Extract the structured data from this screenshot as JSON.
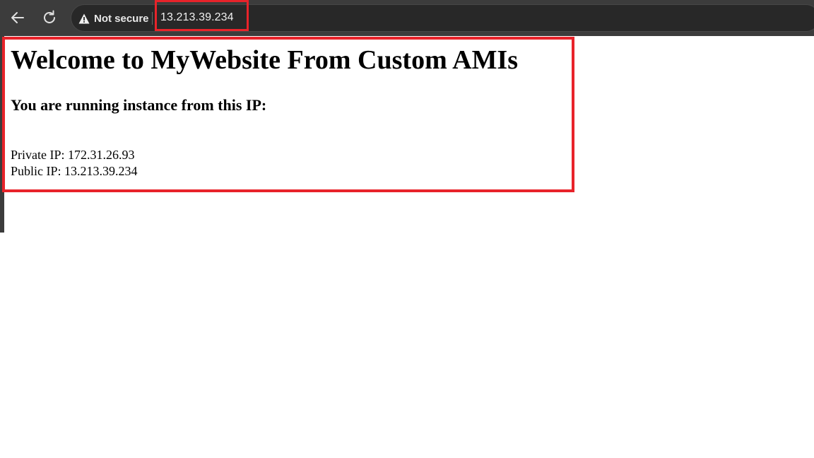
{
  "browser": {
    "security_label": "Not secure",
    "url": "13.213.39.234",
    "icons": {
      "back": "arrow-left-icon",
      "reload": "reload-icon",
      "warning": "warning-triangle-icon"
    }
  },
  "colors": {
    "toolbar_bg": "#3c3c3c",
    "omnibox_bg": "#282828",
    "highlight": "#e8232a"
  },
  "page": {
    "title": "Welcome to MyWebsite From Custom AMIs",
    "subtitle": "You are running instance from this IP:",
    "private_ip_line": "Private IP: 172.31.26.93",
    "public_ip_line": "Public IP: 13.213.39.234"
  }
}
